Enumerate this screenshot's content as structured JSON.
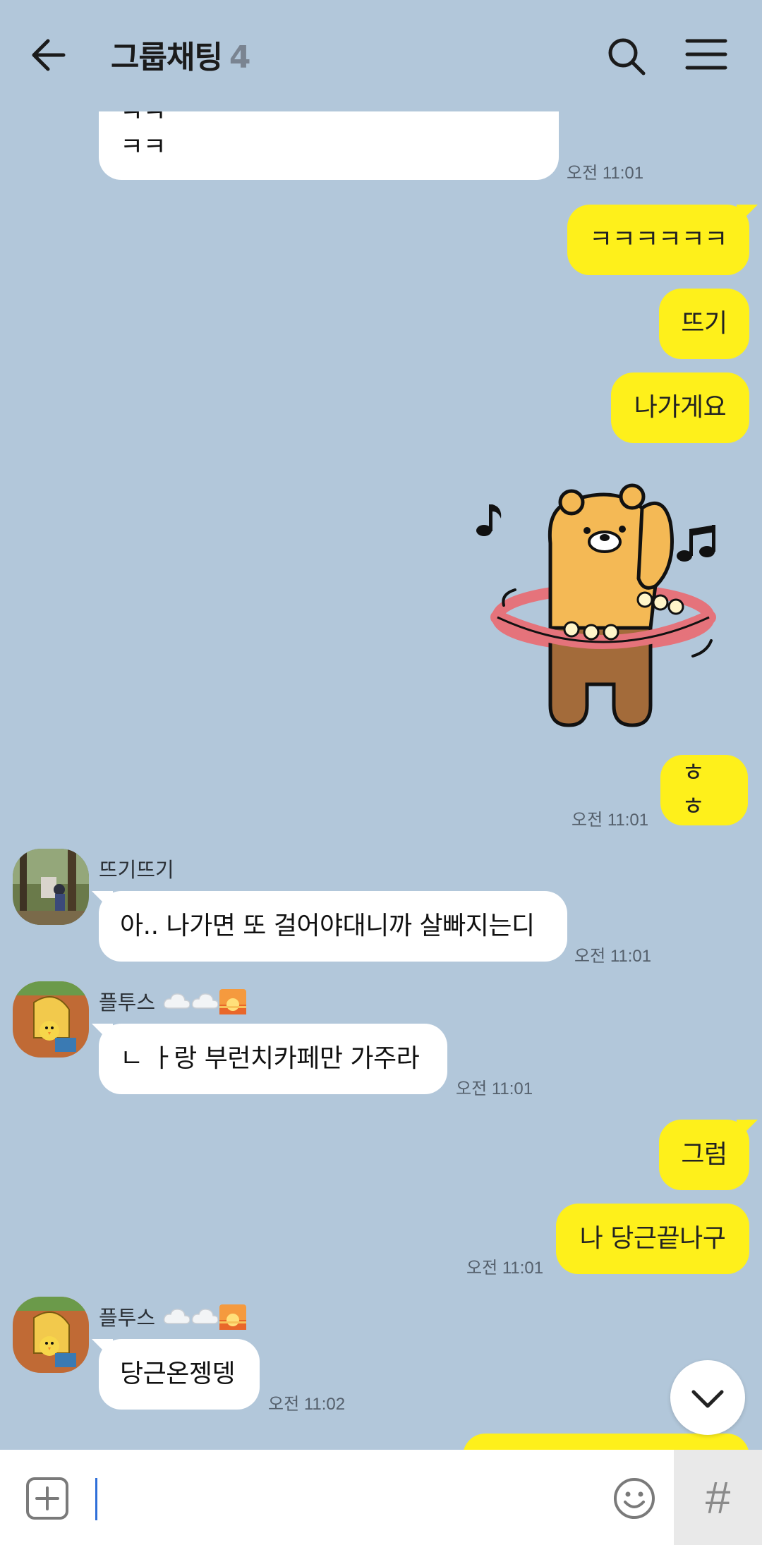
{
  "header": {
    "title": "그룹채팅",
    "member_count": "4",
    "icons": [
      "back-arrow-icon",
      "search-icon",
      "menu-icon"
    ]
  },
  "messages": {
    "m1": {
      "text_line1": "ㅋㅋㅋㅋㅋㅋㅋㅋㅋㅋㅋㅋㅋㅋㅋㅋㅋㅋㅋㅋ",
      "text_line2": "ㅋㅋ",
      "time": "오전 11:01"
    },
    "m2": {
      "text": "ㅋㅋㅋㅋㅋㅋ"
    },
    "m3": {
      "text": "뜨기"
    },
    "m4": {
      "text": "나가게요"
    },
    "sticker": {
      "icon": "hula-hoop-lion-sticker"
    },
    "m5": {
      "text": "ㅎㅎ",
      "time": "오전 11:01"
    },
    "m6": {
      "sender": "뜨기뜨기",
      "text": "아.. 나가면 또 걸어야대니까 살빠지는디",
      "time": "오전 11:01"
    },
    "m7": {
      "sender": "플투스",
      "text": "ㄴ ㅏ랑 부런치카페만 가주라",
      "time": "오전 11:01"
    },
    "m8": {
      "text": "그럼"
    },
    "m9": {
      "text": "나 당근끝나구",
      "time": "오전 11:01"
    },
    "m10": {
      "sender": "플투스",
      "text": "당근온젱뎅",
      "time": "오전 11:02"
    }
  },
  "input": {
    "value": "",
    "hash_label": "#"
  },
  "colors": {
    "background": "#b2c7da",
    "my_bubble": "#fef01b",
    "their_bubble": "#ffffff"
  }
}
